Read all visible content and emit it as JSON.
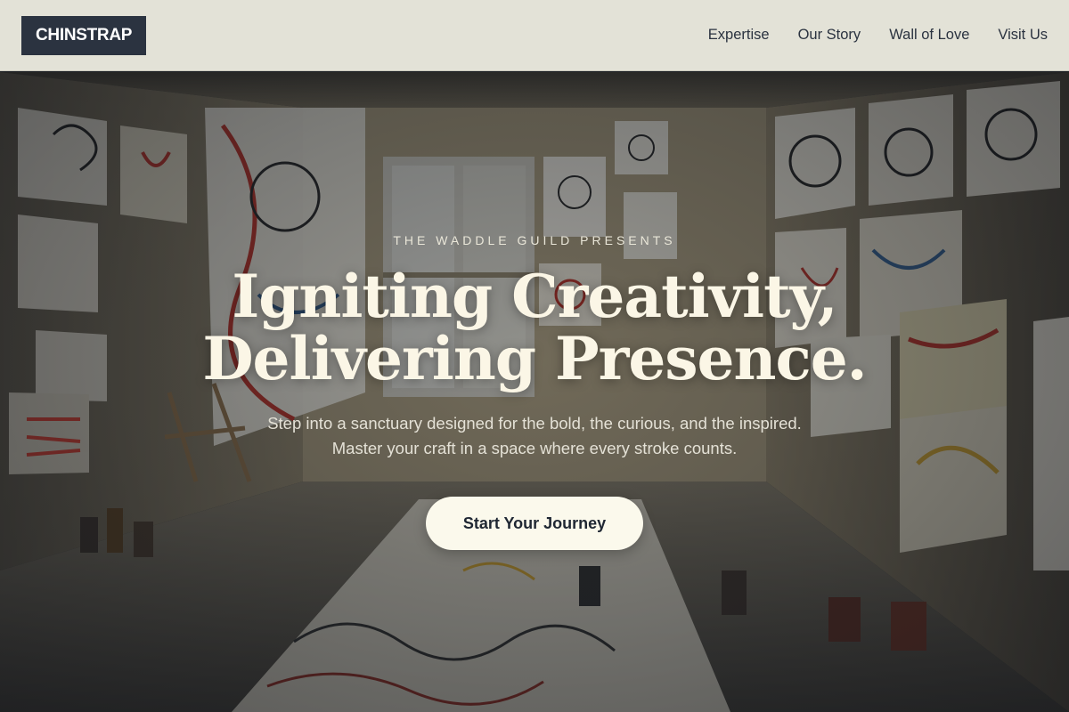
{
  "header": {
    "logo": "CHINSTRAP",
    "nav": [
      {
        "label": "Expertise"
      },
      {
        "label": "Our Story"
      },
      {
        "label": "Wall of Love"
      },
      {
        "label": "Visit Us"
      }
    ]
  },
  "hero": {
    "eyebrow": "THE WADDLE GUILD PRESENTS",
    "headline_line1": "Igniting Creativity,",
    "headline_line2": "Delivering Presence.",
    "subtext": "Step into a sanctuary designed for the bold, the curious, and the inspired. Master your craft in a space where every stroke counts.",
    "cta_label": "Start Your Journey"
  },
  "colors": {
    "header_bg": "#e3e2d7",
    "logo_bg": "#2b3340",
    "cta_bg": "#fbf9ec",
    "headline": "#fbf6e6"
  }
}
